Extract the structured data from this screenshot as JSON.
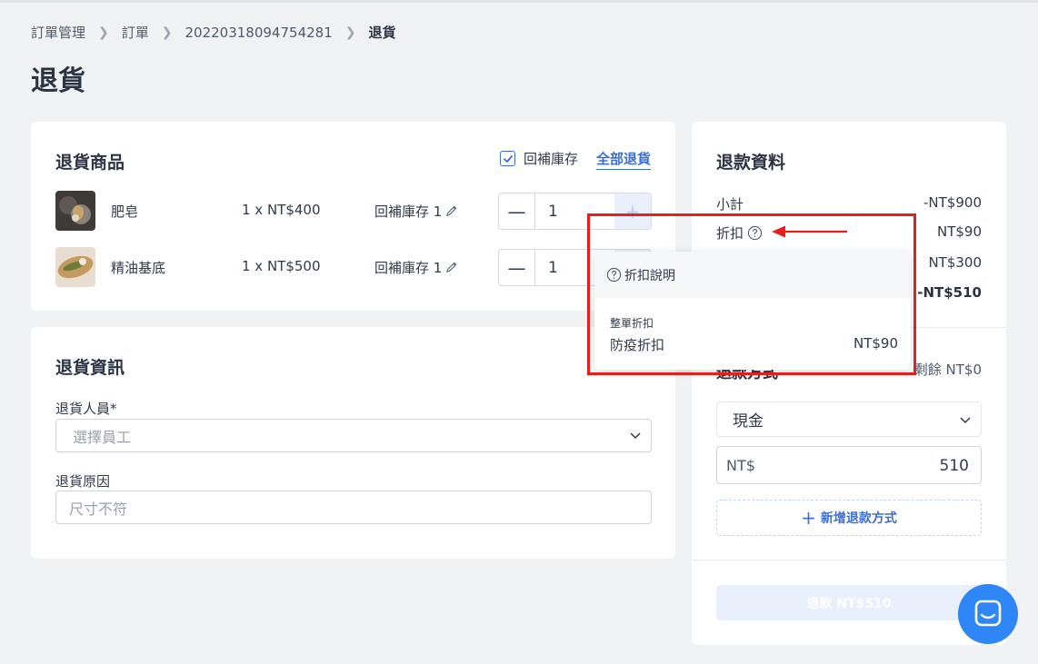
{
  "breadcrumb": {
    "items": [
      "訂單管理",
      "訂單",
      "20220318094754281"
    ],
    "current": "退貨"
  },
  "page_title": "退貨",
  "return_items": {
    "title": "退貨商品",
    "restock_label": "回補庫存",
    "restock_checked": true,
    "return_all_label": "全部退貨",
    "items": [
      {
        "name": "肥皂",
        "price": "1 x NT$400",
        "restock": "回補庫存 1",
        "qty": "1"
      },
      {
        "name": "精油基底",
        "price": "1 x NT$500",
        "restock": "回補庫存 1",
        "qty": "1"
      }
    ]
  },
  "return_info": {
    "title": "退貨資訊",
    "staff_label": "退貨人員*",
    "staff_placeholder": "選擇員工",
    "reason_label": "退貨原因",
    "reason_placeholder": "尺寸不符"
  },
  "refund": {
    "title": "退款資料",
    "subtotal_label": "小計",
    "subtotal_value": "-NT$900",
    "discount_label": "折扣",
    "discount_value": "NT$90",
    "row3_value": "NT$300",
    "total_value": "-NT$510",
    "method_title": "退款方式",
    "remaining": "剩餘 NT$0",
    "method_selected": "現金",
    "currency": "NT$",
    "amount": "510",
    "add_method_label": "新增退款方式",
    "refund_button": "退款 NT$510"
  },
  "discount_popover": {
    "title": "折扣說明",
    "subtitle": "整單折扣",
    "item_label": "防疫折扣",
    "item_value": "NT$90"
  },
  "colors": {
    "accent": "#3b6fd4",
    "annotation": "#e5201c",
    "chat": "#2f86f6"
  }
}
